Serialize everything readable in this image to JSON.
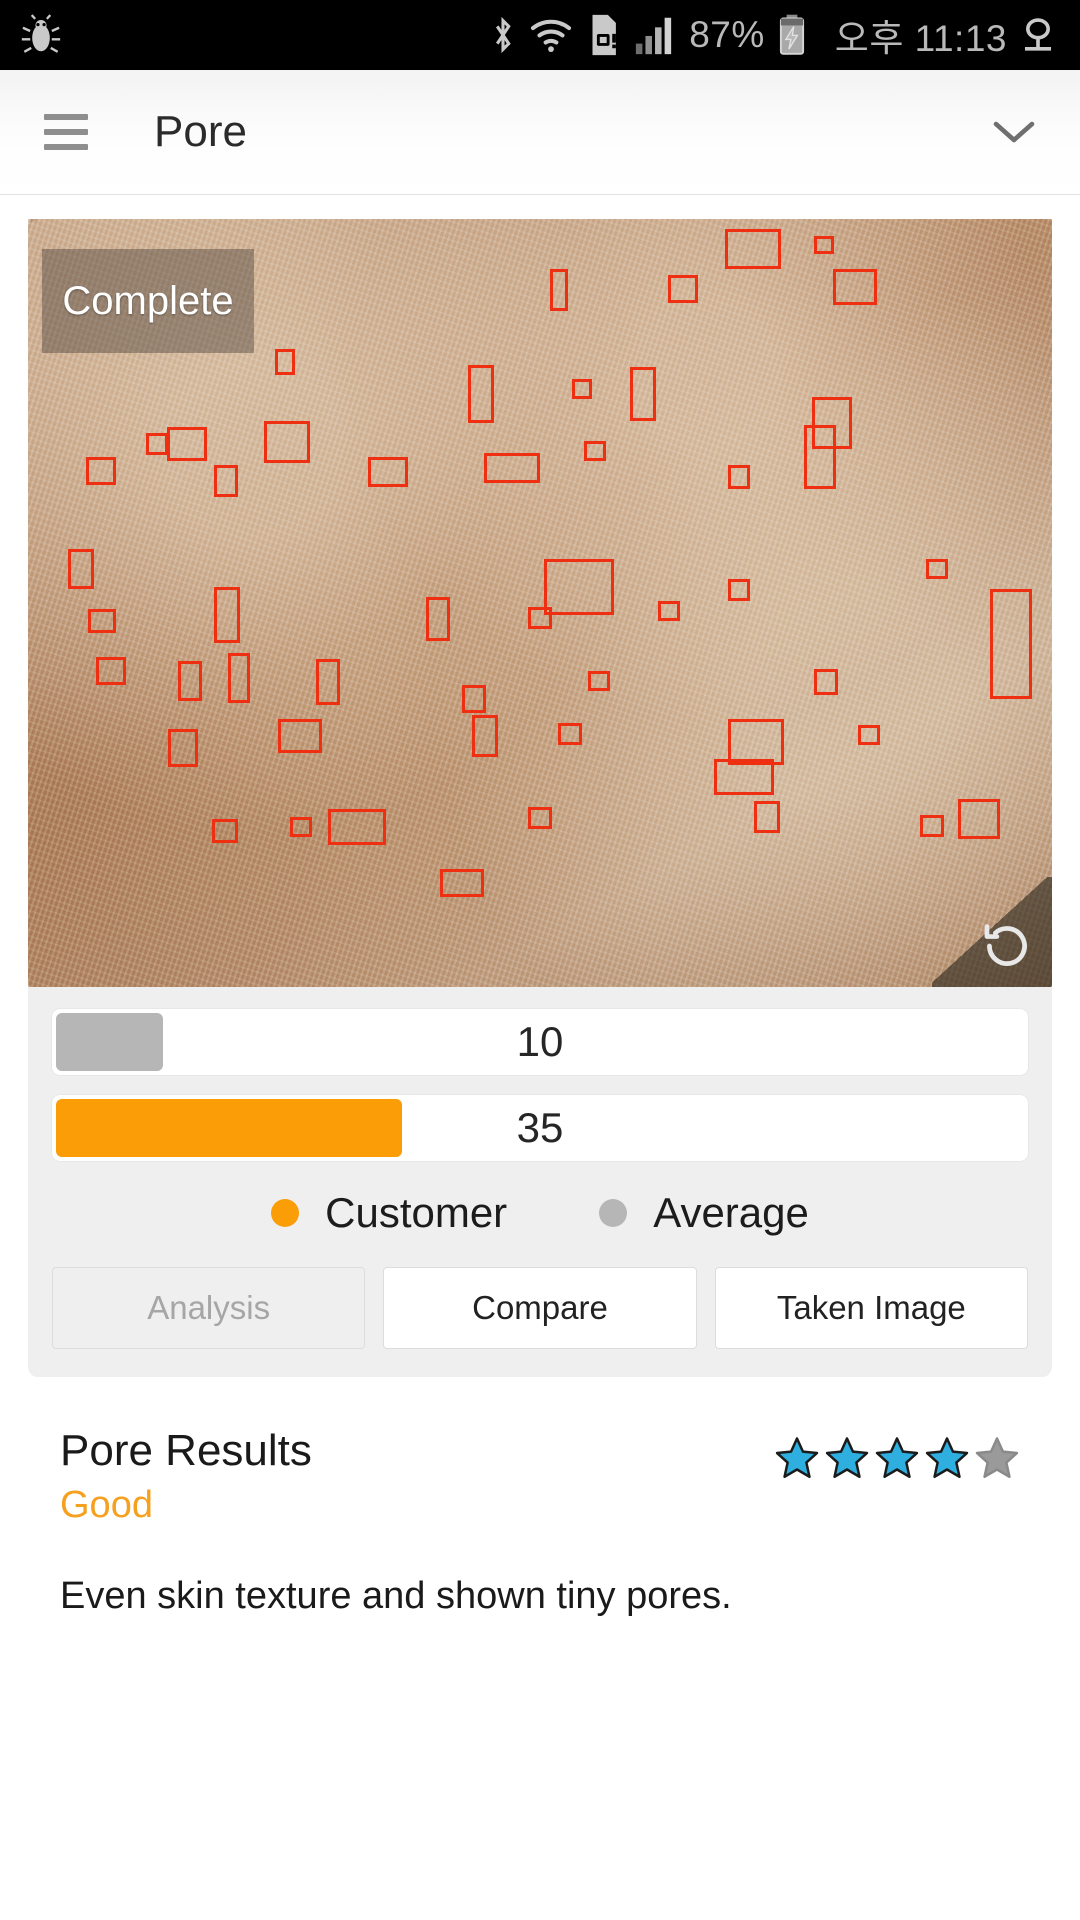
{
  "statusbar": {
    "battery_percent": "87%",
    "time": "오후 11:13",
    "icons": [
      "bug-icon",
      "bluetooth-icon",
      "wifi-icon",
      "sim-card-alert-icon",
      "signal-bars-icon",
      "battery-charging-icon",
      "location-icon"
    ]
  },
  "appbar": {
    "menu_icon": "hamburger-menu-icon",
    "title": "Pore",
    "expand_icon": "chevron-down-icon"
  },
  "photo": {
    "badge": "Complete",
    "reload_icon": "rotate-ccw-icon",
    "annotation_color": "#ef2f12",
    "alt": "magnified-skin-pore-analysis-photo"
  },
  "chart_data": {
    "type": "bar",
    "title": "Pore",
    "orientation": "horizontal",
    "categories": [
      "Average",
      "Customer"
    ],
    "series": [
      {
        "name": "Average",
        "value": 10,
        "color": "#b6b6b6"
      },
      {
        "name": "Customer",
        "value": 35,
        "color": "#fb9d06"
      }
    ],
    "values": [
      10,
      35
    ],
    "value_labels": [
      "10",
      "35"
    ],
    "xlim": [
      0,
      100
    ],
    "grid": false,
    "legend_position": "bottom"
  },
  "legend": [
    {
      "label": "Customer",
      "color": "#fb9d06"
    },
    {
      "label": "Average",
      "color": "#b6b6b6"
    }
  ],
  "tabs": [
    {
      "label": "Analysis",
      "state": "disabled"
    },
    {
      "label": "Compare",
      "state": "active"
    },
    {
      "label": "Taken Image",
      "state": "active"
    }
  ],
  "results": {
    "title": "Pore Results",
    "grade": "Good",
    "grade_color": "#f5a01e",
    "rating": 4,
    "rating_max": 5,
    "star_filled_color": "#2eafe0",
    "star_empty_color": "#9a9a9a",
    "description": "Even skin texture and shown tiny pores."
  }
}
